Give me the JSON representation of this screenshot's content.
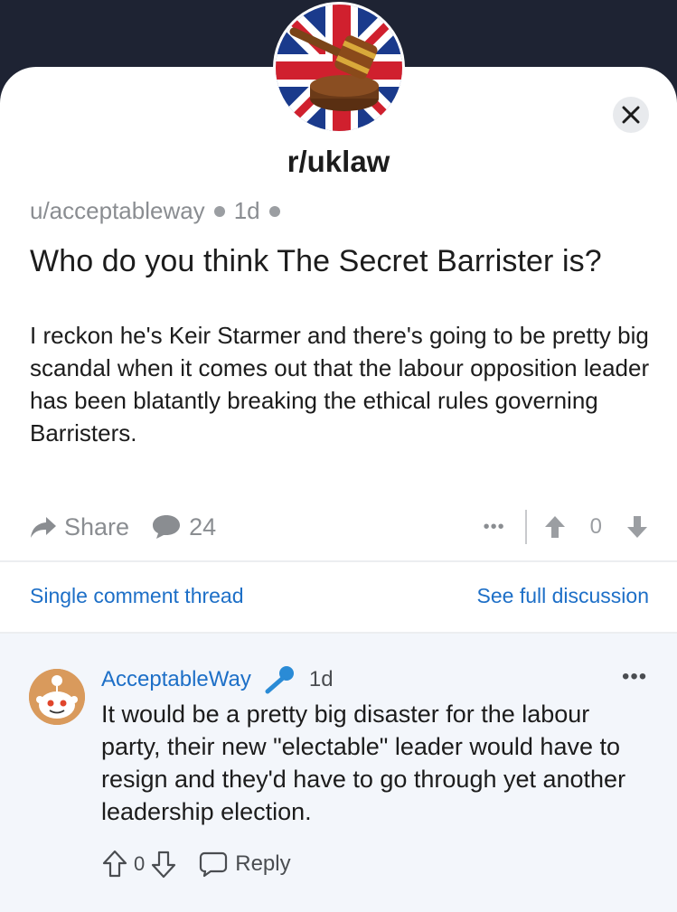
{
  "subreddit": {
    "name": "r/uklaw"
  },
  "post": {
    "author": "u/acceptableway",
    "age": "1d",
    "title": "Who do you think The Secret Barrister is?",
    "body": "I reckon he's Keir Starmer and there's going to be pretty big scandal when it comes out that the labour opposition leader has been blatantly breaking the ethical rules governing Barristers.",
    "share_label": "Share",
    "comment_count": "24",
    "more_label": "•••",
    "score": "0"
  },
  "links": {
    "single_thread": "Single comment thread",
    "full_discussion": "See full discussion"
  },
  "comment": {
    "author": "AcceptableWay",
    "age": "1d",
    "more_label": "•••",
    "body": "It would be a pretty big disaster for the labour party, their new \"electable\" leader would have to resign and they'd have to go through yet another leadership election.",
    "score": "0",
    "reply_label": "Reply"
  },
  "colors": {
    "accent": "#1d6fc7",
    "header_bg": "#1e2333",
    "comment_bg": "#f3f6fb",
    "muted": "#8a8d91"
  },
  "icons": {
    "close": "close-icon",
    "share": "share-arrow-icon",
    "comments": "chat-bubble-icon",
    "upvote": "arrow-up-icon",
    "downvote": "arrow-down-icon",
    "op_badge": "microphone-icon",
    "reply": "reply-bubble-icon"
  }
}
